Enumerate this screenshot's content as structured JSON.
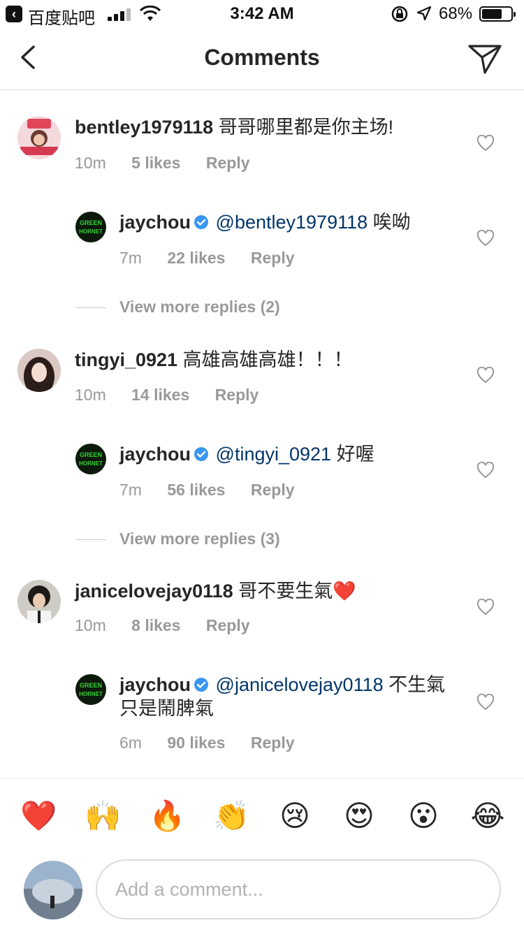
{
  "status_bar": {
    "back_app": "百度贴吧",
    "time": "3:42 AM",
    "battery": "68%"
  },
  "nav": {
    "title": "Comments"
  },
  "comments": [
    {
      "username": "bentley1979118",
      "text": "哥哥哪里都是你主场!",
      "time": "10m",
      "likes": "5 likes",
      "reply": "Reply",
      "verified": false
    },
    {
      "username": "jaychou",
      "mention": "@bentley1979118",
      "text": "唉呦",
      "time": "7m",
      "likes": "22 likes",
      "reply": "Reply",
      "verified": true
    },
    {
      "username": "tingyi_0921",
      "text": "高雄高雄高雄！！！",
      "time": "10m",
      "likes": "14 likes",
      "reply": "Reply",
      "verified": false
    },
    {
      "username": "jaychou",
      "mention": "@tingyi_0921",
      "text": "好喔",
      "time": "7m",
      "likes": "56 likes",
      "reply": "Reply",
      "verified": true
    },
    {
      "username": "janicelovejay0118",
      "text": "哥不要生氣❤️",
      "time": "10m",
      "likes": "8 likes",
      "reply": "Reply",
      "verified": false
    },
    {
      "username": "jaychou",
      "mention": "@janicelovejay0118",
      "text": "不生氣 只是鬧脾氣",
      "time": "6m",
      "likes": "90 likes",
      "reply": "Reply",
      "verified": true
    }
  ],
  "view_more": [
    "View more replies (2)",
    "View more replies (3)"
  ],
  "emoji_bar": [
    "❤️",
    "🙌",
    "🔥",
    "👏",
    "😢",
    "😍",
    "😮",
    "😂"
  ],
  "composer": {
    "placeholder": "Add a comment..."
  },
  "colors": {
    "mention": "#003569",
    "meta": "#999999",
    "verified": "#3897f0"
  },
  "icons": {
    "nav_back": "chevron-left-icon",
    "nav_send": "paper-plane-icon",
    "like": "heart-outline-icon",
    "verified": "verified-badge-icon"
  }
}
